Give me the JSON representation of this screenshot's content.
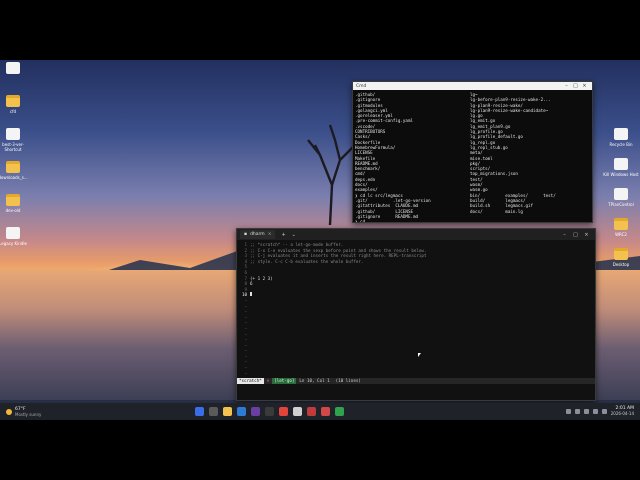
{
  "desktop_icons_left": [
    {
      "label": "",
      "kind": "doc"
    },
    {
      "label": "cfd",
      "kind": "folder"
    },
    {
      "label": "best-3-ver-Shortcut",
      "kind": "doc"
    },
    {
      "label": "downloads_s...",
      "kind": "folder"
    },
    {
      "label": "dev-old",
      "kind": "folder"
    },
    {
      "label": "Legacy Kindle",
      "kind": "doc"
    }
  ],
  "desktop_icons_right": [
    {
      "label": "Recycle Bin",
      "kind": "doc"
    },
    {
      "label": "Kill Windows Host",
      "kind": "doc"
    },
    {
      "label": "TPlanControl",
      "kind": "doc"
    },
    {
      "label": "WRC2",
      "kind": "folder"
    },
    {
      "label": "Desktop",
      "kind": "folder"
    }
  ],
  "term1": {
    "title": "Cmd",
    "col1": ".github/\n.gitignore\n.gitmodules\n.golangci.yml\n.goreleaser.yml\n.pre-commit-config.yaml\n.vscode/\nCONTRIBUTORS\nCasks/\nDockerfile\nHomebrewFormula/\nLICENSE\nMakefile\nREADME.md\nbenchmark/\ncmd/\ndeps.edn\ndocs/\nexamples/\n❯ cd lc src/legmacs\n.git/          .let-go-version\n.gitattributes  CLAUDE.md\n.github/        LICENSE\n.gitignore      README.md\n❯ cd",
    "col2": "lg~\nlg-before-plan9-resize-wake-2...\nlg-plan9-resize-wake/\nlg-plan9-resize-wake-candidate~\nlg.go\nlg_emit.go\nlg_emit_plan9.go\nlg_profile.go\nlg_profile_default.go\nlg_repl.go\nlg_repl_stub.go\nmeta/\nmise.toml\npkg/\nscripts/\ntop_migrations.json\ntest/\nwasm/\nwasm.go\nbin/          examples/      test/\nbuild/        legmacs/\nbuild.sh      legmacs.gif\ndocs/         main.lg"
  },
  "term2": {
    "tab_title": "dharm",
    "new_tab": "+",
    "lines": [
      {
        "n": "1",
        "text": ";; *scratch* -- a let-go-mode buffer.",
        "kind": "comment"
      },
      {
        "n": "2",
        "text": ";; C-x C-e evaluates the sexp before point and shows the result below.",
        "kind": "comment"
      },
      {
        "n": "3",
        "text": ";; C-j evaluates it and inserts the result right here. REPL-transcript",
        "kind": "comment"
      },
      {
        "n": "4",
        "text": ";; style. C-c C-b evaluates the whole buffer.",
        "kind": "comment"
      },
      {
        "n": "5",
        "text": "",
        "kind": "code"
      },
      {
        "n": "6",
        "text": "",
        "kind": "code"
      },
      {
        "n": "7",
        "text": "(+ 1 2 3)",
        "kind": "code"
      },
      {
        "n": "8",
        "text": "6",
        "kind": "code"
      },
      {
        "n": "9",
        "text": "",
        "kind": "code"
      },
      {
        "n": "10",
        "text": "",
        "kind": "cursor"
      }
    ],
    "status": {
      "mode": "*scratch*",
      "modified": "×",
      "lang": "[let-go]",
      "pos": "Ln 10, Col 1",
      "lines": "(10 lines)"
    }
  },
  "taskbar": {
    "weather_temp": "67°F",
    "weather_desc": "Mostly sunny",
    "time": "2:01 AM",
    "date": "2026-04-14",
    "apps": [
      "#3a6ee8",
      "#5a5a5a",
      "#f2c14e",
      "#2d7bd4",
      "#6b3fa0",
      "#3a3a3a",
      "#e0443a",
      "#d0d0d0",
      "#c23b3b",
      "#d24747",
      "#2fa14f"
    ]
  }
}
